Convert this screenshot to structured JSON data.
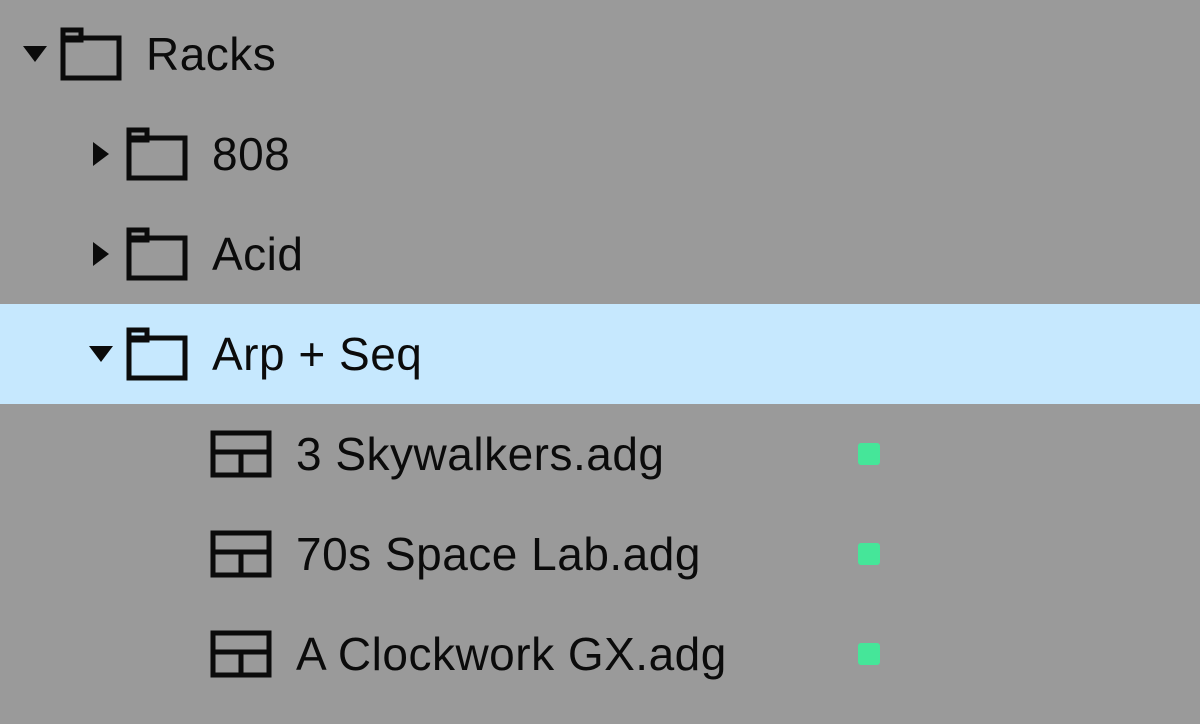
{
  "tree": {
    "root": {
      "label": "Racks",
      "expanded": true,
      "children": [
        {
          "type": "folder",
          "label": "808",
          "expanded": false,
          "selected": false
        },
        {
          "type": "folder",
          "label": "Acid",
          "expanded": false,
          "selected": false
        },
        {
          "type": "folder",
          "label": "Arp + Seq",
          "expanded": true,
          "selected": true,
          "children": [
            {
              "type": "file",
              "label": "3 Skywalkers.adg",
              "status": true
            },
            {
              "type": "file",
              "label": "70s Space Lab.adg",
              "status": true
            },
            {
              "type": "file",
              "label": "A Clockwork GX.adg",
              "status": true
            }
          ]
        }
      ]
    }
  }
}
